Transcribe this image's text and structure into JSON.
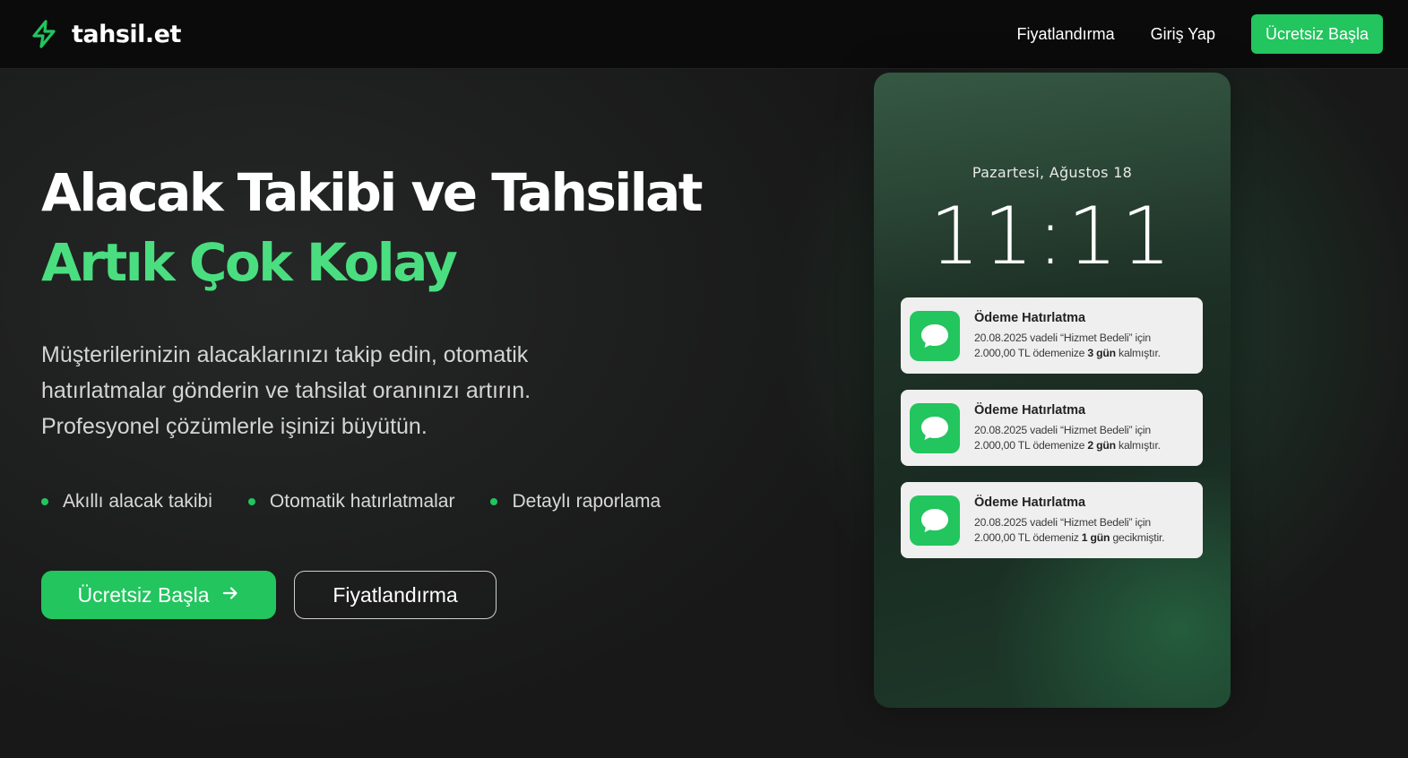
{
  "header": {
    "logo_text": "tahsil.et",
    "nav": {
      "pricing": "Fiyatlandırma",
      "login": "Giriş Yap",
      "cta": "Ücretsiz Başla"
    }
  },
  "hero": {
    "title_line1": "Alacak Takibi ve Tahsilat",
    "title_line2": "Artık Çok Kolay",
    "description": "Müşterilerinizin alacaklarınızı takip edin, otomatik hatırlatmalar gönderin ve tahsilat oranınızı artırın. Profesyonel çözümlerle işinizi büyütün.",
    "features": [
      "Akıllı alacak takibi",
      "Otomatik hatırlatmalar",
      "Detaylı raporlama"
    ],
    "primary_button": "Ücretsiz Başla",
    "secondary_button": "Fiyatlandırma"
  },
  "phone": {
    "date": "Pazartesi, Ağustos 18",
    "time": "11:11",
    "notifications": [
      {
        "title": "Ödeme Hatırlatma",
        "line1": "20.08.2025 vadeli “Hizmet Bedeli” için",
        "line2_pre": "2.000,00 TL ödemenize ",
        "line2_bold": "3 gün",
        "line2_post": " kalmıştır."
      },
      {
        "title": "Ödeme Hatırlatma",
        "line1": "20.08.2025 vadeli “Hizmet Bedeli” için",
        "line2_pre": "2.000,00 TL ödemenize ",
        "line2_bold": "2 gün",
        "line2_post": " kalmıştır."
      },
      {
        "title": "Ödeme Hatırlatma",
        "line1": "20.08.2025 vadeli “Hizmet Bedeli” için",
        "line2_pre": "2.000,00 TL ödemeniz ",
        "line2_bold": "1 gün",
        "line2_post": " gecikmiştir."
      }
    ]
  },
  "colors": {
    "accent": "#22c55e",
    "accent_light": "#4ade80",
    "header_bg": "#0b0b0b",
    "page_bg": "#1b1c1c"
  },
  "icons": {
    "logo": "lightning-bolt-icon",
    "arrow": "arrow-right-icon",
    "notification": "message-bubble-icon"
  }
}
